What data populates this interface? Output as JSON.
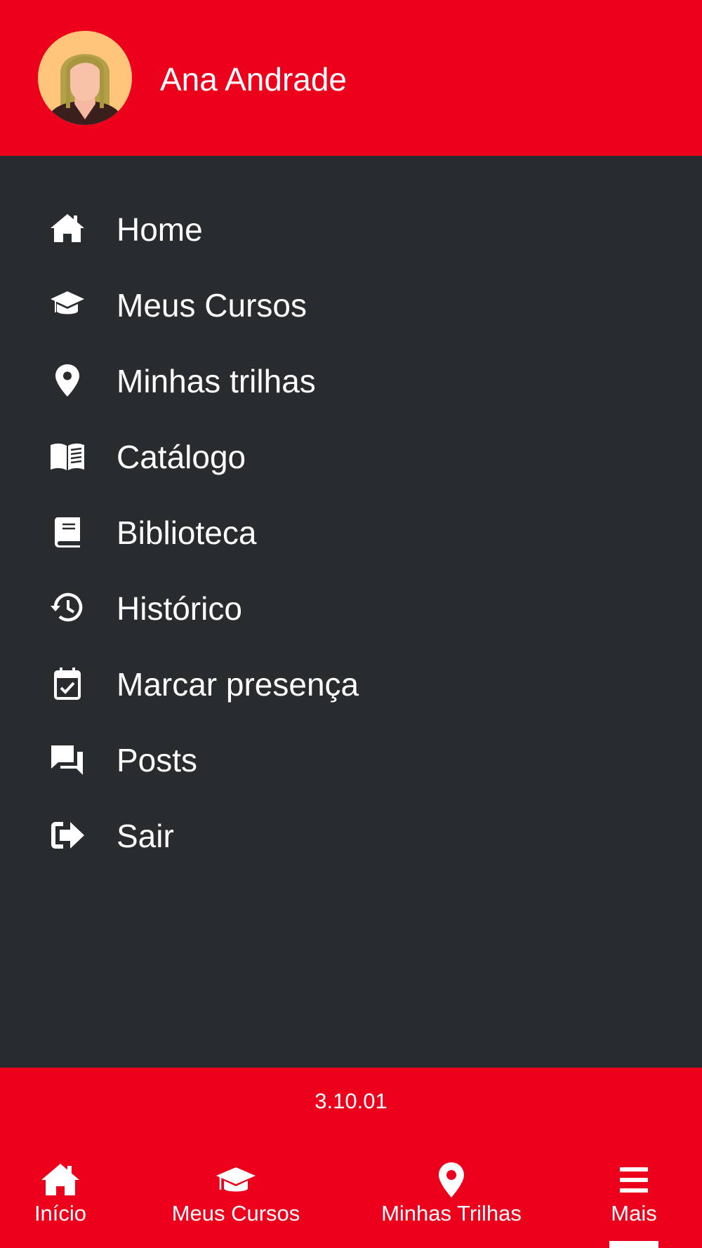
{
  "user": {
    "name": "Ana Andrade",
    "avatar_icon": "user-avatar"
  },
  "menu": {
    "items": [
      {
        "label": "Home",
        "icon": "home-icon"
      },
      {
        "label": "Meus Cursos",
        "icon": "graduation-cap-icon"
      },
      {
        "label": "Minhas trilhas",
        "icon": "map-marker-icon"
      },
      {
        "label": "Catálogo",
        "icon": "open-book-icon"
      },
      {
        "label": "Biblioteca",
        "icon": "book-icon"
      },
      {
        "label": "Histórico",
        "icon": "history-icon"
      },
      {
        "label": "Marcar presença",
        "icon": "calendar-check-icon"
      },
      {
        "label": "Posts",
        "icon": "forum-icon"
      },
      {
        "label": "Sair",
        "icon": "sign-out-icon"
      }
    ]
  },
  "footer": {
    "version": "3.10.01"
  },
  "bottom_nav": {
    "tabs": [
      {
        "label": "Início",
        "icon": "home-icon"
      },
      {
        "label": "Meus Cursos",
        "icon": "graduation-cap-icon"
      },
      {
        "label": "Minhas Trilhas",
        "icon": "map-marker-icon"
      },
      {
        "label": "Mais",
        "icon": "hamburger-menu-icon",
        "active": true
      }
    ]
  },
  "colors": {
    "brand_red": "#ec001c",
    "drawer_background": "#292c2f",
    "text": "#ffffff"
  }
}
